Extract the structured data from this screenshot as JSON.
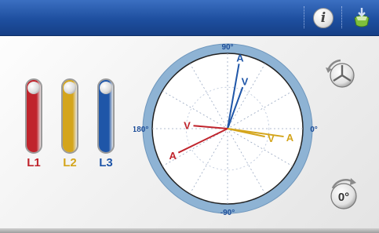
{
  "header": {
    "info_icon_label": "i",
    "app_icon_name": "phase-meter-app-icon"
  },
  "phases": [
    {
      "label": "L1",
      "color": "#c0242c",
      "level": 1.0
    },
    {
      "label": "L2",
      "color": "#d4a51c",
      "level": 1.0
    },
    {
      "label": "L3",
      "color": "#1f56a8",
      "level": 1.0
    }
  ],
  "dial": {
    "labels": {
      "top": "90°",
      "right": "0°",
      "bottom": "-90°",
      "left": "180°"
    },
    "vector_labels": {
      "current": "A",
      "voltage": "V"
    },
    "vectors": [
      {
        "phase": "L3",
        "type": "A",
        "angle_deg": 80,
        "magnitude": 1.0
      },
      {
        "phase": "L3",
        "type": "V",
        "angle_deg": 70,
        "magnitude": 0.67
      },
      {
        "phase": "L2",
        "type": "A",
        "angle_deg": -8,
        "magnitude": 0.86
      },
      {
        "phase": "L2",
        "type": "V",
        "angle_deg": -12,
        "magnitude": 0.58
      },
      {
        "phase": "L1",
        "type": "A",
        "angle_deg": 206,
        "magnitude": 0.83
      },
      {
        "phase": "L1",
        "type": "V",
        "angle_deg": 175,
        "magnitude": 0.52
      }
    ]
  },
  "controls": {
    "rotate_icon_name": "phase-rotation-icon",
    "zero_label": "0°"
  }
}
